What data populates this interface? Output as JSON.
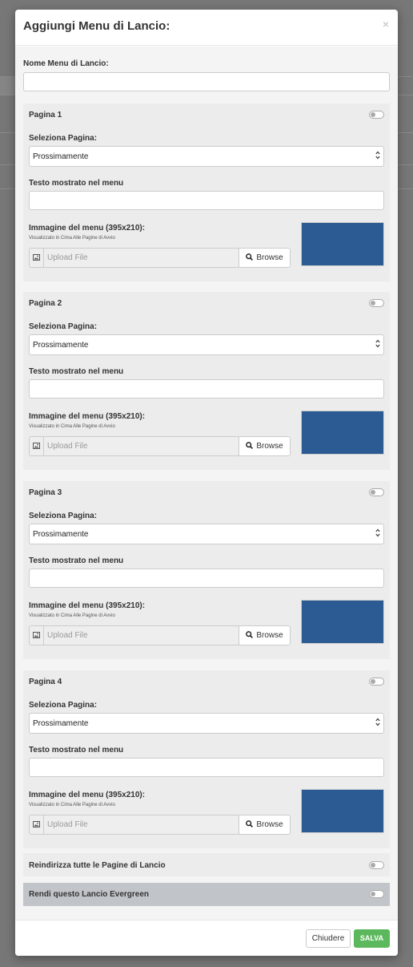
{
  "modal": {
    "title": "Aggiungi Menu di Lancio:",
    "close_glyph": "×"
  },
  "name_field": {
    "label": "Nome Menu di Lancio:",
    "value": ""
  },
  "pages": [
    {
      "title": "Pagina 1",
      "select_label": "Seleziona Pagina:",
      "select_value": "Prossimamente",
      "text_label": "Testo mostrato nel menu",
      "text_value": "",
      "image_label": "Immagine del menu (395x210):",
      "image_hint": "Visualizzato in Cima Alle Pagine di Avvio",
      "upload_placeholder": "Upload File",
      "browse_label": "Browse"
    },
    {
      "title": "Pagina 2",
      "select_label": "Seleziona Pagina:",
      "select_value": "Prossimamente",
      "text_label": "Testo mostrato nel menu",
      "text_value": "",
      "image_label": "Immagine del menu (395x210):",
      "image_hint": "Visualizzato in Cima Alle Pagine di Avvio",
      "upload_placeholder": "Upload File",
      "browse_label": "Browse"
    },
    {
      "title": "Pagina 3",
      "select_label": "Seleziona Pagina:",
      "select_value": "Prossimamente",
      "text_label": "Testo mostrato nel menu",
      "text_value": "",
      "image_label": "Immagine del menu (395x210):",
      "image_hint": "Visualizzato in Cima Alle Pagine di Avvio",
      "upload_placeholder": "Upload File",
      "browse_label": "Browse"
    },
    {
      "title": "Pagina 4",
      "select_label": "Seleziona Pagina:",
      "select_value": "Prossimamente",
      "text_label": "Testo mostrato nel menu",
      "text_value": "",
      "image_label": "Immagine del menu (395x210):",
      "image_hint": "Visualizzato in Cima Alle Pagine di Avvio",
      "upload_placeholder": "Upload File",
      "browse_label": "Browse"
    }
  ],
  "redirect_option": {
    "label": "Reindirizza tutte le Pagine di Lancio",
    "enabled": false
  },
  "evergreen_option": {
    "label": "Rendi questo Lancio Evergreen",
    "enabled": false
  },
  "footer": {
    "close_label": "Chiudere",
    "save_label": "SALVA"
  },
  "colors": {
    "preview": "#2b5b92",
    "save": "#5cb85c",
    "section_bg": "#ececec",
    "evergreen_bg": "#c1c5c9"
  },
  "icons": {
    "upload": "image-icon",
    "browse": "search-icon",
    "select": "chevron-updown-icon"
  }
}
